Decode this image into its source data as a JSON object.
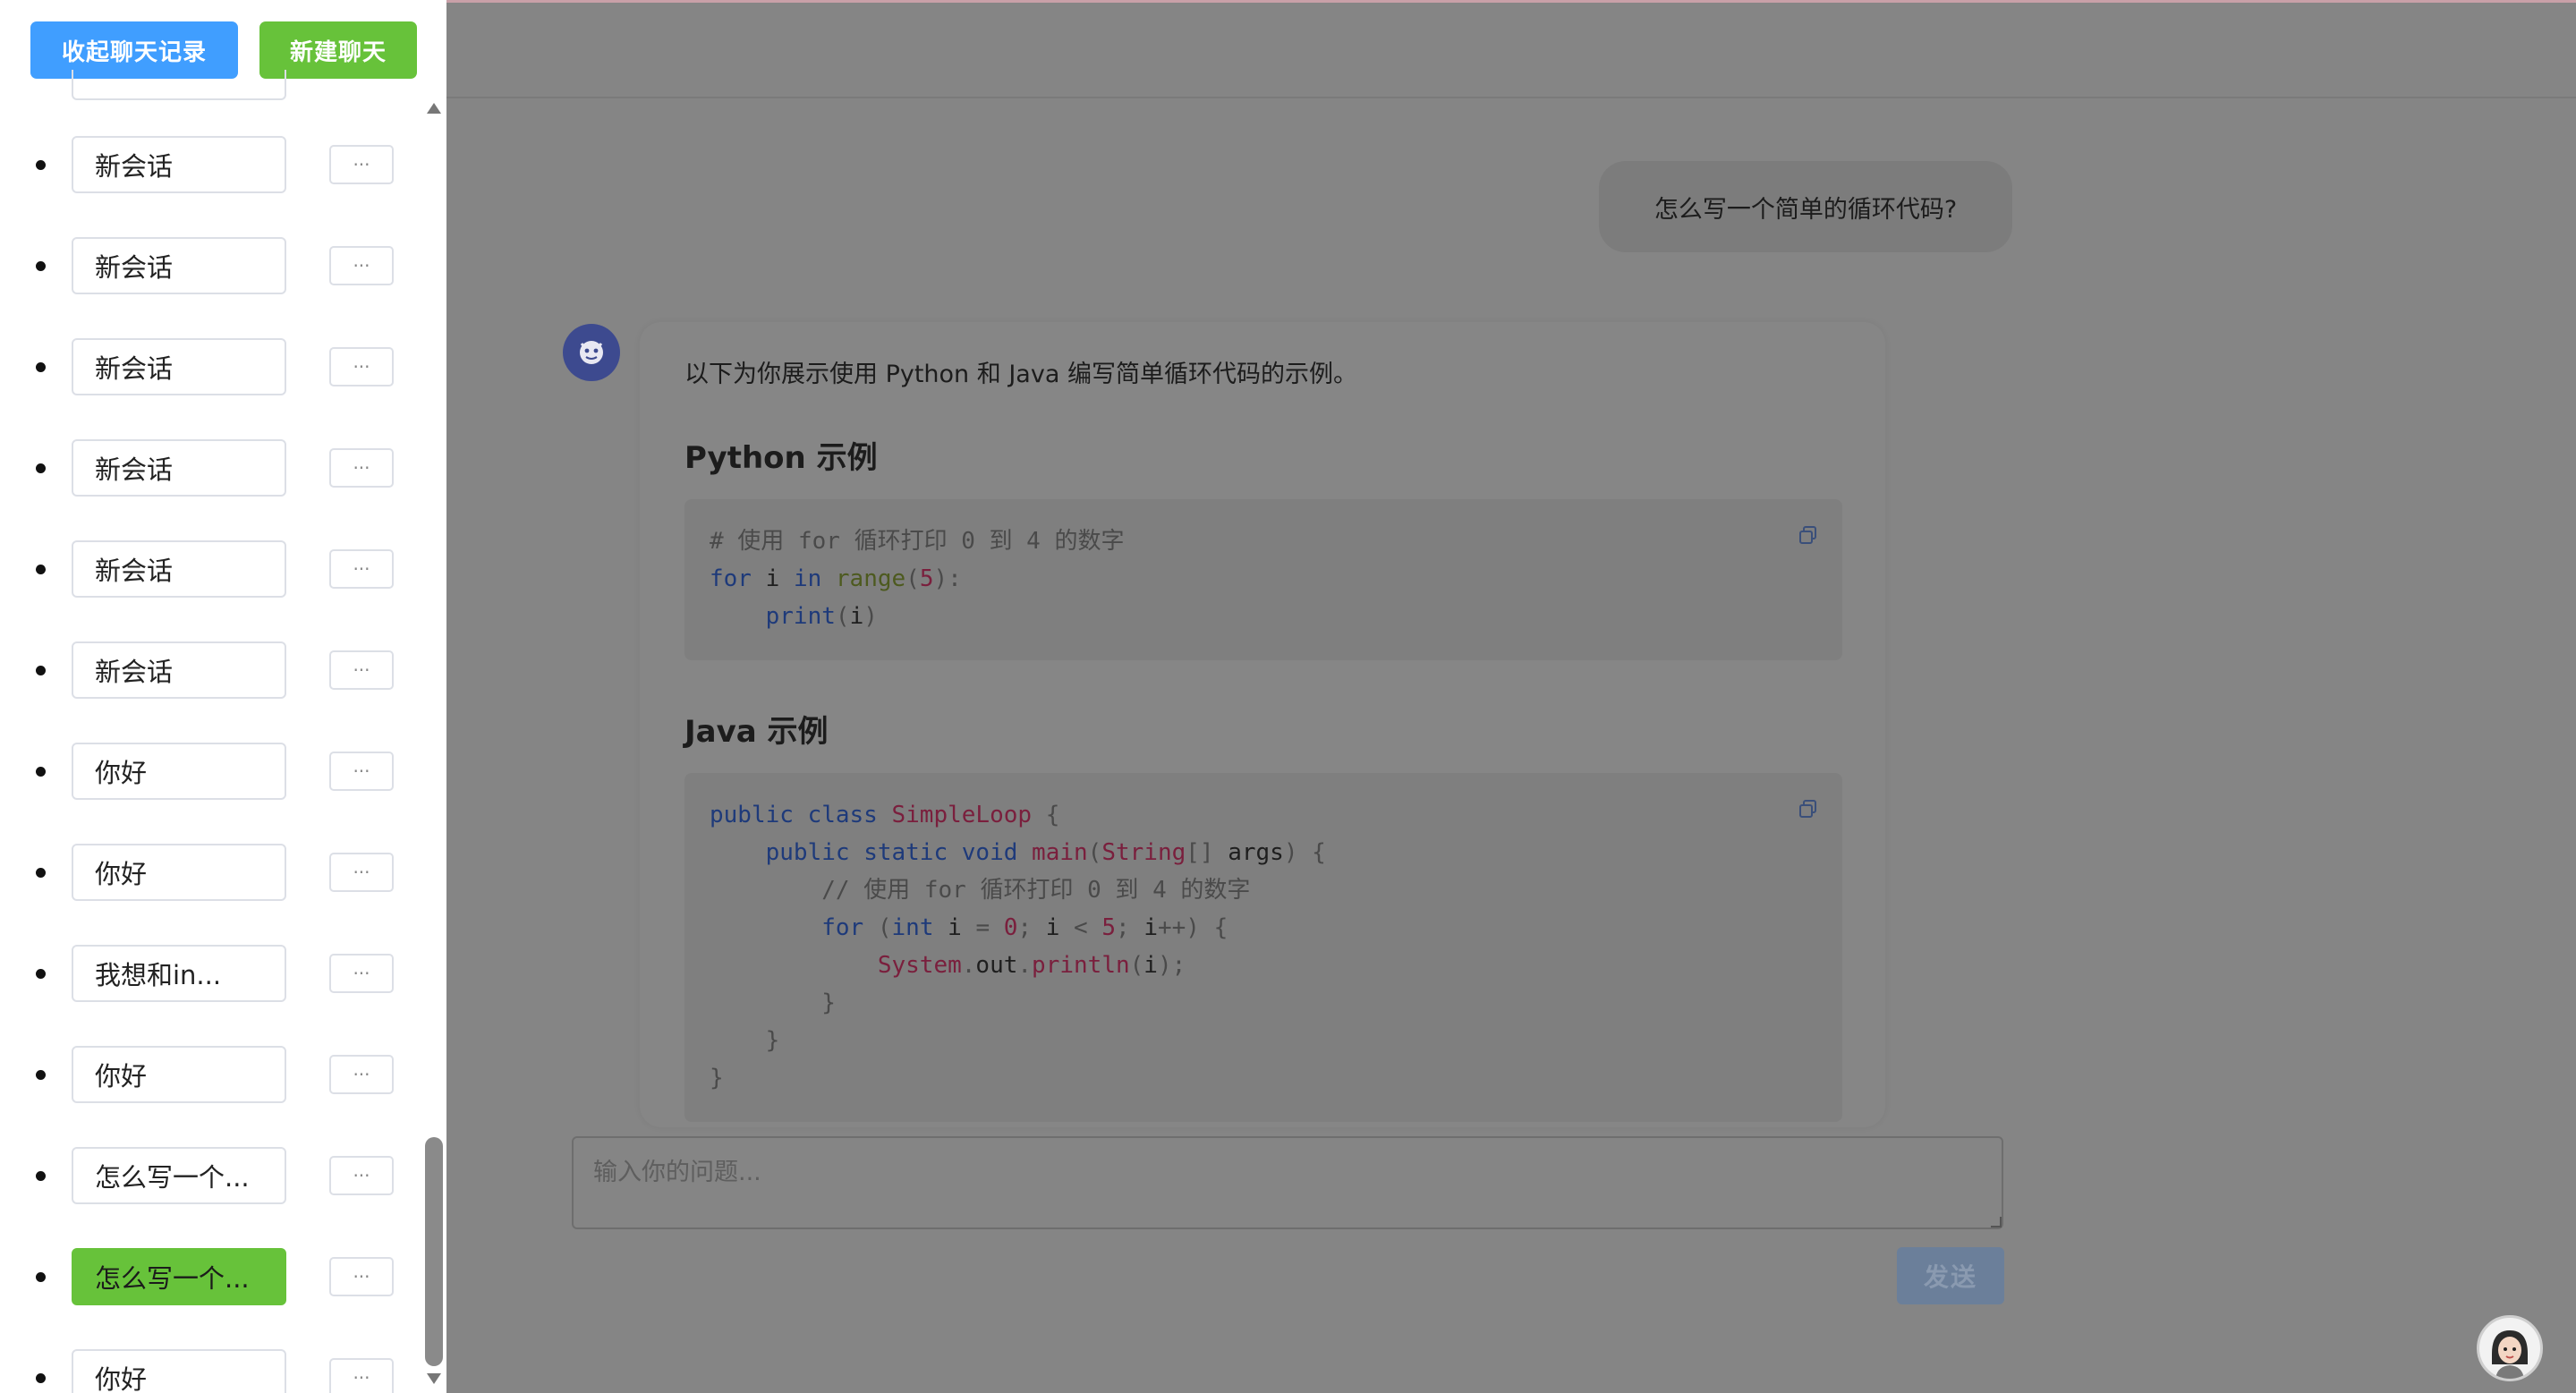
{
  "sidebar": {
    "collapse_label": "收起聊天记录",
    "new_chat_label": "新建聊天",
    "more_label": "···",
    "conversations": [
      {
        "title": "新会话",
        "active": false
      },
      {
        "title": "新会话",
        "active": false
      },
      {
        "title": "新会话",
        "active": false
      },
      {
        "title": "新会话",
        "active": false
      },
      {
        "title": "新会话",
        "active": false
      },
      {
        "title": "新会话",
        "active": false
      },
      {
        "title": "你好",
        "active": false
      },
      {
        "title": "你好",
        "active": false
      },
      {
        "title": "我想和in...",
        "active": false
      },
      {
        "title": "你好",
        "active": false
      },
      {
        "title": "怎么写一个...",
        "active": false
      },
      {
        "title": "怎么写一个...",
        "active": true
      },
      {
        "title": "你好",
        "active": false
      }
    ]
  },
  "chat": {
    "user_message": "怎么写一个简单的循环代码?",
    "bot_intro": "以下为你展示使用 Python 和 Java 编写简单循环代码的示例。",
    "python_heading": "Python 示例",
    "java_heading": "Java 示例",
    "python_code": [
      "# 使用 for 循环打印 0 到 4 的数字",
      "for i in range(5):",
      "    print(i)"
    ],
    "java_code": [
      "public class SimpleLoop {",
      "    public static void main(String[] args) {",
      "        // 使用 for 循环打印 0 到 4 的数字",
      "        for (int i = 0; i < 5; i++) {",
      "            System.out.println(i);",
      "        }",
      "    }",
      "}"
    ]
  },
  "input": {
    "placeholder": "输入你的问题...",
    "send_label": "发送"
  },
  "colors": {
    "primary": "#409eff",
    "success": "#67c23a",
    "overlay": "#858585"
  },
  "icons": {
    "bot_avatar": "bot-avatar-icon",
    "copy": "copy-icon",
    "helper": "helper-avatar-icon"
  }
}
